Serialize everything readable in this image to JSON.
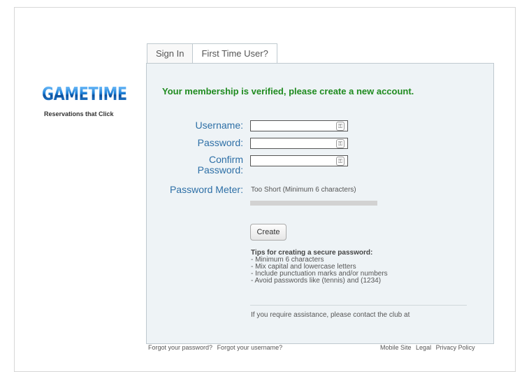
{
  "brand": {
    "name": "GAMETIME",
    "tagline": "Reservations that Click"
  },
  "tabs": [
    {
      "label": "Sign In"
    },
    {
      "label": "First Time User?"
    }
  ],
  "verified_message": "Your membership is verified, please create a new account.",
  "form": {
    "username_label": "Username:",
    "password_label": "Password:",
    "confirm_label_line1": "Confirm",
    "confirm_label_line2": "Password:",
    "meter_label": "Password Meter:",
    "meter_status": "Too Short (Minimum 6 characters)",
    "meter_fill_fraction": 0,
    "create_label": "Create"
  },
  "tips": {
    "title": "Tips for creating a secure password:",
    "items": [
      "- Minimum 6 characters",
      "- Mix capital and lowercase letters",
      "- Include punctuation marks and/or numbers",
      "- Avoid passwords like (tennis) and (1234)"
    ]
  },
  "assistance_text": "If you require assistance, please contact the club at",
  "footer": {
    "forgot_password": "Forgot your password?",
    "forgot_username": "Forgot your username?",
    "mobile_site": "Mobile Site",
    "legal": "Legal",
    "privacy": "Privacy Policy"
  },
  "colors": {
    "brand_blue": "#1a6fb4",
    "label_blue": "#2d6fa6",
    "success_green": "#1f8b1f"
  },
  "icons": {
    "field_icon": "key-icon"
  }
}
